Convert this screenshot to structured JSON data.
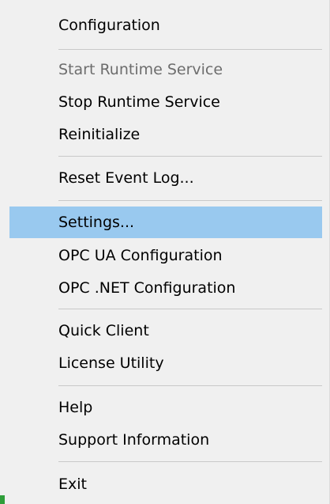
{
  "menu": {
    "items": [
      {
        "label": "Configuration"
      },
      {
        "label": "Start Runtime Service"
      },
      {
        "label": "Stop Runtime Service"
      },
      {
        "label": "Reinitialize"
      },
      {
        "label": "Reset Event Log..."
      },
      {
        "label": "Settings..."
      },
      {
        "label": "OPC UA Configuration"
      },
      {
        "label": "OPC .NET Configuration"
      },
      {
        "label": "Quick Client"
      },
      {
        "label": "License Utility"
      },
      {
        "label": "Help"
      },
      {
        "label": "Support Information"
      },
      {
        "label": "Exit"
      }
    ],
    "disabled_item": "Start Runtime Service",
    "selected_item": "Settings...",
    "colors": {
      "menu_background": "#f0f0f0",
      "selected_background": "#99c9ef",
      "disabled_text": "#6d6d6d",
      "separator": "#c9c9c9",
      "taskbar_accent": "#2f9e3a"
    }
  }
}
